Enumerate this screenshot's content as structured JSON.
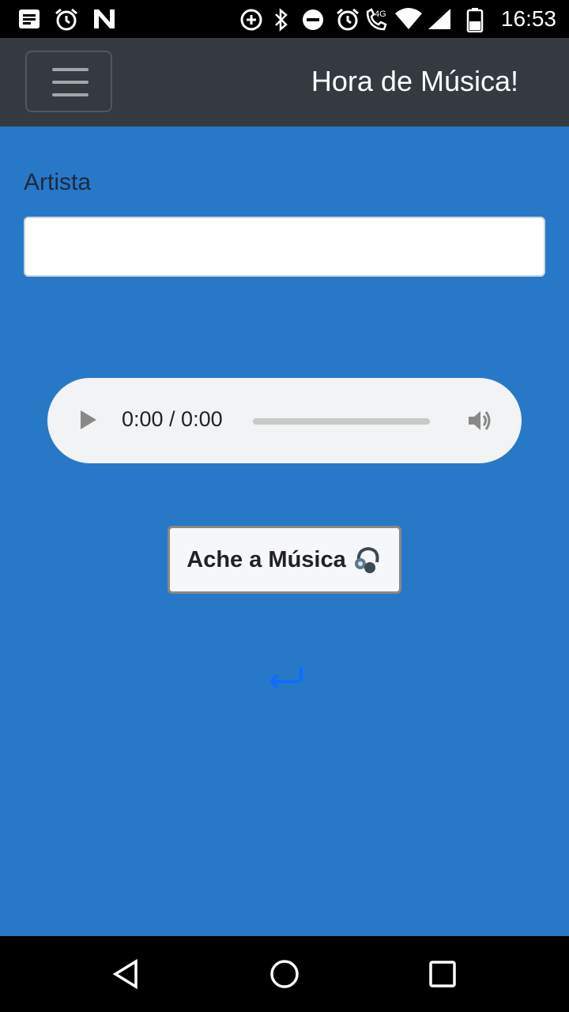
{
  "status_bar": {
    "time": "16:53",
    "network": "4G",
    "icons": [
      "notes-icon",
      "alarm-icon",
      "n-app-icon",
      "data-saver-icon",
      "bluetooth-icon",
      "do-not-disturb-icon",
      "alarm-icon",
      "wifi-call-icon",
      "wifi-icon",
      "signal-icon",
      "battery-icon"
    ]
  },
  "navbar": {
    "brand": "Hora de Música!",
    "menu_icon": "hamburger-icon"
  },
  "form": {
    "artist_label": "Artista",
    "artist_value": "",
    "artist_placeholder": ""
  },
  "audio": {
    "time_display": "0:00 / 0:00",
    "progress": 0
  },
  "search_button": {
    "label": "Ache a Música",
    "icon": "headphones-icon"
  },
  "back_link": {
    "icon": "return-arrow-icon"
  },
  "system_nav": {
    "buttons": [
      "back-icon",
      "home-icon",
      "recents-icon"
    ]
  },
  "colors": {
    "background": "#2878c8",
    "navbar": "#343a40",
    "text_dark": "#1e2a3c"
  }
}
